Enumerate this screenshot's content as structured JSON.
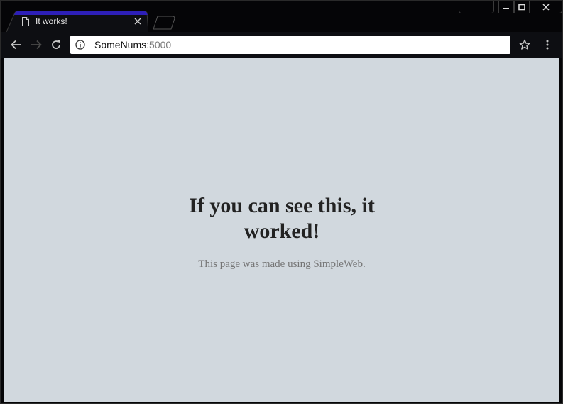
{
  "tab": {
    "title": "It works!",
    "accent_color": "#2d1fb8"
  },
  "address_bar": {
    "host": "SomeNums",
    "port": ":5000"
  },
  "page": {
    "heading": "If you can see this, it worked!",
    "made_prefix": "This page was made using ",
    "link_text": "SimpleWeb",
    "made_suffix": ".",
    "background_color": "#d1d8de"
  },
  "icons": {
    "back": "arrow-left-icon",
    "forward": "arrow-right-icon",
    "reload": "reload-icon",
    "info": "info-icon",
    "bookmark": "star-icon",
    "menu": "vertical-dots-icon",
    "tab_page": "page-icon",
    "tab_close": "close-icon",
    "minimize": "minimize-icon",
    "maximize": "maximize-icon",
    "close": "close-icon"
  }
}
